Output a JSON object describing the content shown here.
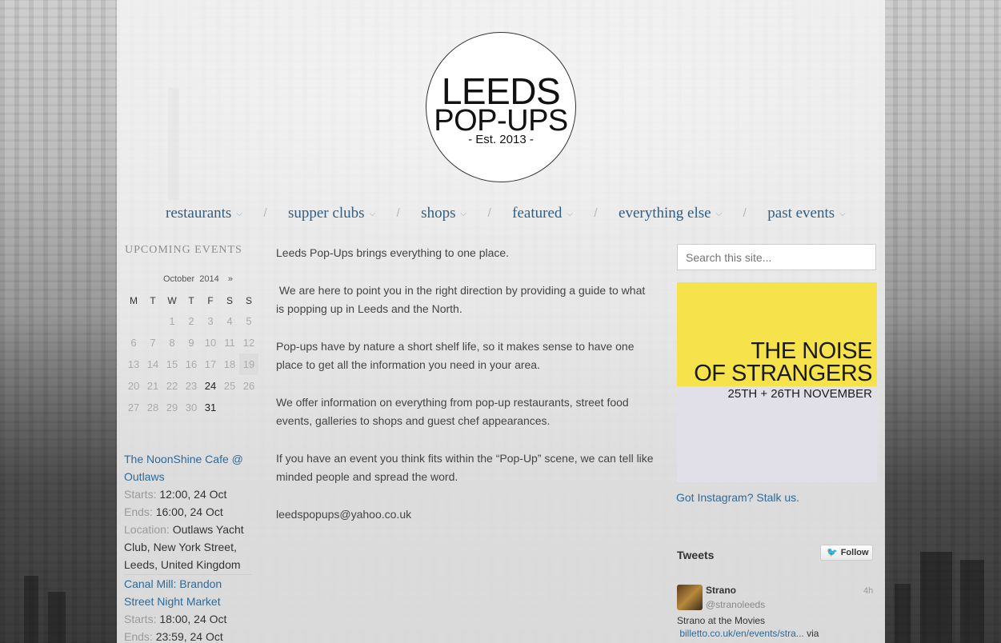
{
  "logo": {
    "line1": "LEEDS",
    "line2": "POP-UPS",
    "line3": "- Est. 2013 -"
  },
  "nav": {
    "items": [
      {
        "label": "restaurants"
      },
      {
        "label": "supper clubs"
      },
      {
        "label": "shops"
      },
      {
        "label": "featured"
      },
      {
        "label": "everything else"
      },
      {
        "label": "past events"
      }
    ],
    "separator": "/",
    "chevron": "⌵"
  },
  "sidebar": {
    "title": "UPCOMING EVENTS",
    "calendar": {
      "month": "October",
      "year": "2014",
      "next": "»",
      "weekdays": [
        "M",
        "T",
        "W",
        "T",
        "F",
        "S",
        "S"
      ],
      "weeks": [
        [
          "",
          "",
          "1",
          "2",
          "3",
          "4",
          "5"
        ],
        [
          "6",
          "7",
          "8",
          "9",
          "10",
          "11",
          "12"
        ],
        [
          "13",
          "14",
          "15",
          "16",
          "17",
          "18",
          "19"
        ],
        [
          "20",
          "21",
          "22",
          "23",
          "24",
          "25",
          "26"
        ],
        [
          "27",
          "28",
          "29",
          "30",
          "31",
          "",
          ""
        ]
      ],
      "event_days": [
        "24",
        "31"
      ],
      "today": "19"
    },
    "events": [
      {
        "title": "The NoonShine Cafe @ Outlaws",
        "starts_label": "Starts:",
        "starts": "12:00, 24 Oct",
        "ends_label": "Ends:",
        "ends": "16:00, 24 Oct",
        "location_label": "Location:",
        "location": "Outlaws Yacht Club, New York Street, Leeds, United Kingdom"
      },
      {
        "title": "Canal Mill: Brandon Street Night Market",
        "starts_label": "Starts:",
        "starts": "18:00, 24 Oct",
        "ends_label": "Ends:",
        "ends": "23:59, 24 Oct"
      }
    ]
  },
  "main": {
    "paragraphs": [
      "Leeds Pop-Ups brings everything to one place.",
      " We are here to point you in the right direction by providing a guide to what is popping up in Leeds and the North.",
      "Pop-ups have by nature a short shelf life, so it makes sense to have one place to get all the information you need in your area.",
      "We offer information on everything from pop-up restaurants, street food events, galleries to shops and guest chef appearances.",
      "If you have an event you think fits within the “Pop-Up” scene, we can tell like minded people and spread the word.",
      "leedspopups@yahoo.co.uk"
    ]
  },
  "right": {
    "search_placeholder": "Search this site...",
    "ad": {
      "line1": "THE NOISE",
      "line2": "OF STRANGERS",
      "line3": "25TH + 26TH NOVEMBER"
    },
    "instagram": "Got Instagram? Stalk us.",
    "tweets": {
      "heading": "Tweets",
      "follow": "Follow",
      "tweet": {
        "name": "Strano",
        "handle": "@stranoleeds",
        "time": "4h",
        "text": "Strano at the Movies",
        "link": "billetto.co.uk/en/events/stra...",
        "via": " via"
      }
    }
  },
  "colors": {
    "link": "#2f6a96",
    "nav": "#2f5f86",
    "ad_yellow": "#f6e24a"
  }
}
